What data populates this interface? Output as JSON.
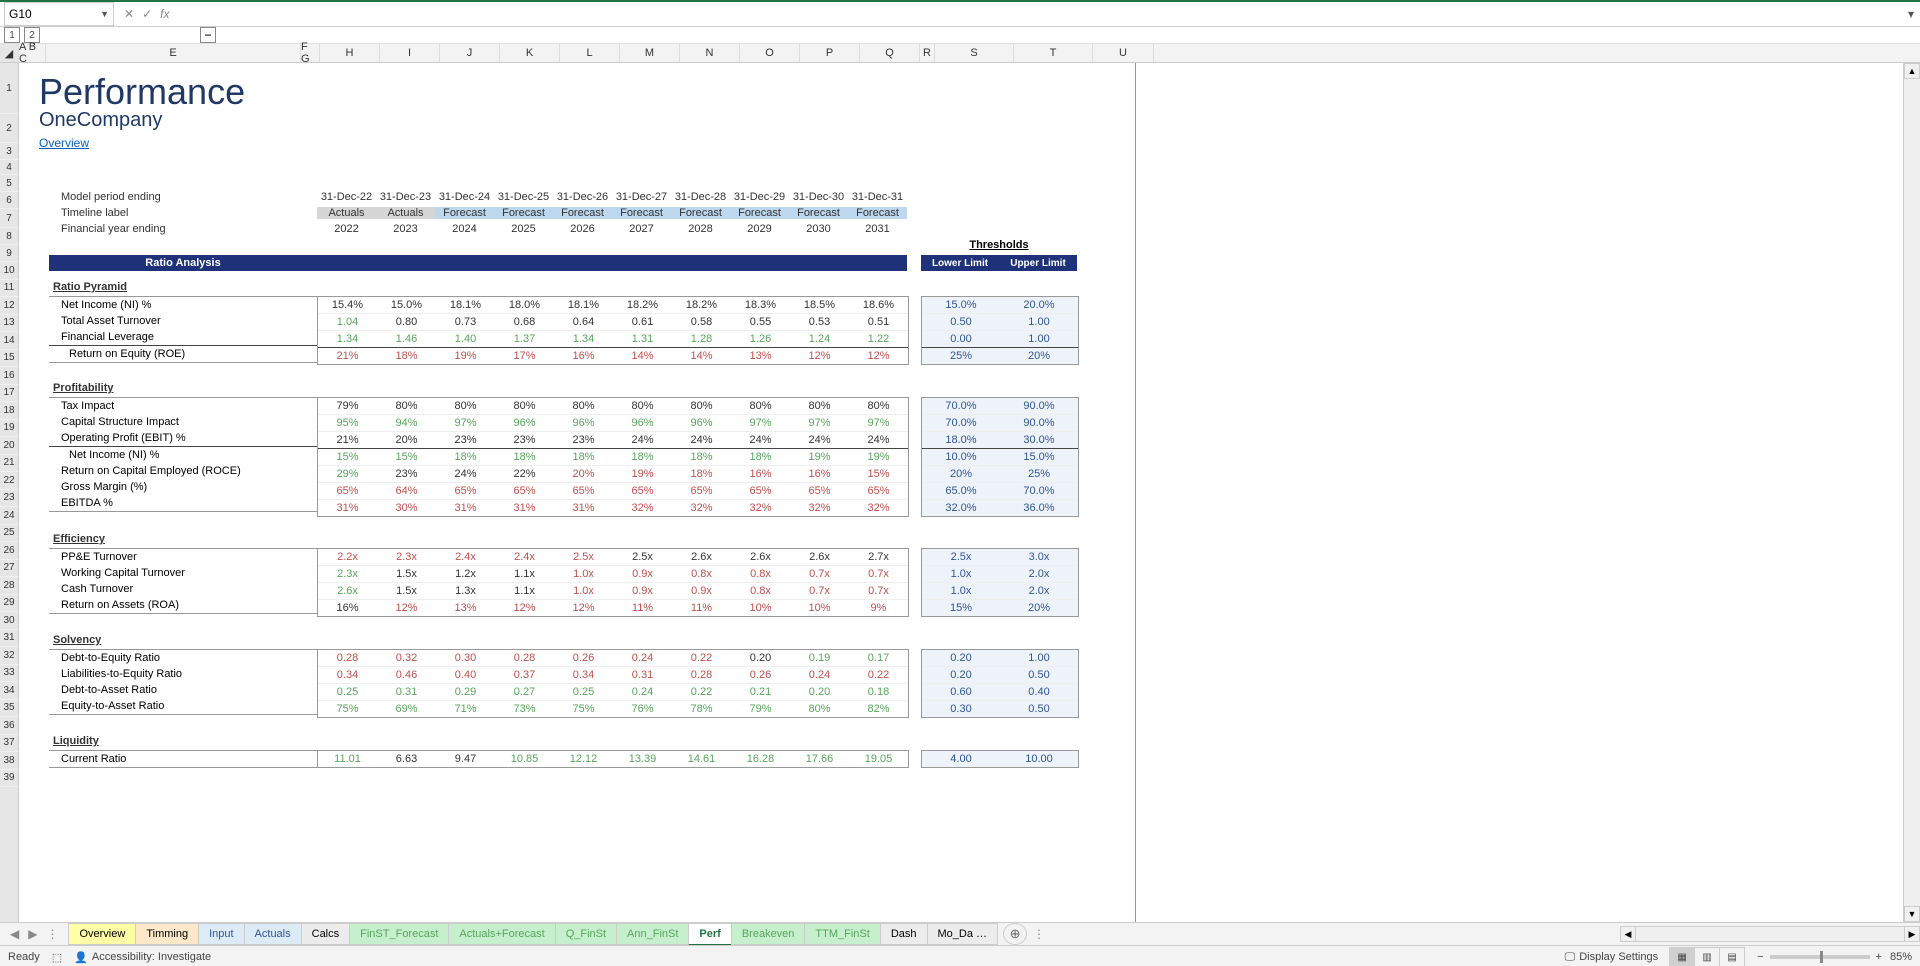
{
  "name_box": "G10",
  "title": "Performance",
  "subtitle": "OneCompany",
  "overview_link": "Overview",
  "outline_labels": [
    "1",
    "2",
    "−"
  ],
  "col_headers": [
    "A",
    "B",
    "C",
    "E",
    "F",
    "G",
    "H",
    "I",
    "J",
    "K",
    "L",
    "M",
    "N",
    "O",
    "P",
    "Q",
    "S",
    "T",
    "U"
  ],
  "meta_rows": {
    "model_period_label": "Model period ending",
    "model_period": [
      "31-Dec-22",
      "31-Dec-23",
      "31-Dec-24",
      "31-Dec-25",
      "31-Dec-26",
      "31-Dec-27",
      "31-Dec-28",
      "31-Dec-29",
      "31-Dec-30",
      "31-Dec-31"
    ],
    "timeline_label": "Timeline label",
    "timeline": [
      "Actuals",
      "Actuals",
      "Forecast",
      "Forecast",
      "Forecast",
      "Forecast",
      "Forecast",
      "Forecast",
      "Forecast",
      "Forecast"
    ],
    "fy_label": "Financial year ending",
    "fy": [
      "2022",
      "2023",
      "2024",
      "2025",
      "2026",
      "2027",
      "2028",
      "2029",
      "2030",
      "2031"
    ]
  },
  "section_bar": "Ratio Analysis",
  "thresholds_label": "Thresholds",
  "th_headers": [
    "Lower Limit",
    "Upper Limit"
  ],
  "groups": [
    {
      "heading": "Ratio Pyramid",
      "rows": [
        {
          "label": "Net Income (NI) %",
          "indent": 1,
          "v": [
            "15.4%",
            "15.0%",
            "18.1%",
            "18.0%",
            "18.1%",
            "18.2%",
            "18.2%",
            "18.3%",
            "18.5%",
            "18.6%"
          ],
          "c": [
            "black",
            "black",
            "black",
            "black",
            "black",
            "black",
            "black",
            "black",
            "black",
            "black"
          ],
          "th": [
            "15.0%",
            "20.0%"
          ]
        },
        {
          "label": "Total Asset Turnover",
          "indent": 1,
          "v": [
            "1.04",
            "0.80",
            "0.73",
            "0.68",
            "0.64",
            "0.61",
            "0.58",
            "0.55",
            "0.53",
            "0.51"
          ],
          "c": [
            "green",
            "black",
            "black",
            "black",
            "black",
            "black",
            "black",
            "black",
            "black",
            "black"
          ],
          "th": [
            "0.50",
            "1.00"
          ]
        },
        {
          "label": "Financial Leverage",
          "indent": 1,
          "v": [
            "1.34",
            "1.46",
            "1.40",
            "1.37",
            "1.34",
            "1.31",
            "1.28",
            "1.26",
            "1.24",
            "1.22"
          ],
          "c": [
            "green",
            "green",
            "green",
            "green",
            "green",
            "green",
            "green",
            "green",
            "green",
            "green"
          ],
          "th": [
            "0.00",
            "1.00"
          ],
          "bb": true
        },
        {
          "label": "Return on Equity (ROE)",
          "indent": 2,
          "v": [
            "21%",
            "18%",
            "19%",
            "17%",
            "16%",
            "14%",
            "14%",
            "13%",
            "12%",
            "12%"
          ],
          "c": [
            "red",
            "red",
            "red",
            "red",
            "red",
            "red",
            "red",
            "red",
            "red",
            "red"
          ],
          "th": [
            "25%",
            "20%"
          ],
          "summary": true
        }
      ]
    },
    {
      "heading": "Profitability",
      "rows": [
        {
          "label": "Tax Impact",
          "indent": 1,
          "v": [
            "79%",
            "80%",
            "80%",
            "80%",
            "80%",
            "80%",
            "80%",
            "80%",
            "80%",
            "80%"
          ],
          "c": [
            "black",
            "black",
            "black",
            "black",
            "black",
            "black",
            "black",
            "black",
            "black",
            "black"
          ],
          "th": [
            "70.0%",
            "90.0%"
          ]
        },
        {
          "label": "Capital Structure Impact",
          "indent": 1,
          "v": [
            "95%",
            "94%",
            "97%",
            "96%",
            "96%",
            "96%",
            "96%",
            "97%",
            "97%",
            "97%"
          ],
          "c": [
            "green",
            "green",
            "green",
            "green",
            "green",
            "green",
            "green",
            "green",
            "green",
            "green"
          ],
          "th": [
            "70.0%",
            "90.0%"
          ]
        },
        {
          "label": "Operating Profit (EBIT) %",
          "indent": 1,
          "v": [
            "21%",
            "20%",
            "23%",
            "23%",
            "23%",
            "24%",
            "24%",
            "24%",
            "24%",
            "24%"
          ],
          "c": [
            "black",
            "black",
            "black",
            "black",
            "black",
            "black",
            "black",
            "black",
            "black",
            "black"
          ],
          "th": [
            "18.0%",
            "30.0%"
          ],
          "bb": true
        },
        {
          "label": "Net Income (NI) %",
          "indent": 2,
          "v": [
            "15%",
            "15%",
            "18%",
            "18%",
            "18%",
            "18%",
            "18%",
            "18%",
            "19%",
            "19%"
          ],
          "c": [
            "green",
            "green",
            "green",
            "green",
            "green",
            "green",
            "green",
            "green",
            "green",
            "green"
          ],
          "th": [
            "10.0%",
            "15.0%"
          ],
          "summary": true
        },
        {
          "label": "Return on Capital Employed (ROCE)",
          "indent": 1,
          "v": [
            "29%",
            "23%",
            "24%",
            "22%",
            "20%",
            "19%",
            "18%",
            "16%",
            "16%",
            "15%"
          ],
          "c": [
            "green",
            "black",
            "black",
            "black",
            "red",
            "red",
            "red",
            "red",
            "red",
            "red"
          ],
          "th": [
            "20%",
            "25%"
          ]
        },
        {
          "label": "Gross Margin (%)",
          "indent": 1,
          "v": [
            "65%",
            "64%",
            "65%",
            "65%",
            "65%",
            "65%",
            "65%",
            "65%",
            "65%",
            "65%"
          ],
          "c": [
            "red",
            "red",
            "red",
            "red",
            "red",
            "red",
            "red",
            "red",
            "red",
            "red"
          ],
          "th": [
            "65.0%",
            "70.0%"
          ]
        },
        {
          "label": "EBITDA %",
          "indent": 1,
          "v": [
            "31%",
            "30%",
            "31%",
            "31%",
            "31%",
            "32%",
            "32%",
            "32%",
            "32%",
            "32%"
          ],
          "c": [
            "red",
            "red",
            "red",
            "red",
            "red",
            "red",
            "red",
            "red",
            "red",
            "red"
          ],
          "th": [
            "32.0%",
            "36.0%"
          ]
        }
      ]
    },
    {
      "heading": "Efficiency",
      "rows": [
        {
          "label": "PP&E Turnover",
          "indent": 1,
          "v": [
            "2.2x",
            "2.3x",
            "2.4x",
            "2.4x",
            "2.5x",
            "2.5x",
            "2.6x",
            "2.6x",
            "2.6x",
            "2.7x"
          ],
          "c": [
            "red",
            "red",
            "red",
            "red",
            "red",
            "black",
            "black",
            "black",
            "black",
            "black"
          ],
          "th": [
            "2.5x",
            "3.0x"
          ]
        },
        {
          "label": "Working Capital Turnover",
          "indent": 1,
          "v": [
            "2.3x",
            "1.5x",
            "1.2x",
            "1.1x",
            "1.0x",
            "0.9x",
            "0.8x",
            "0.8x",
            "0.7x",
            "0.7x"
          ],
          "c": [
            "green",
            "black",
            "black",
            "black",
            "red",
            "red",
            "red",
            "red",
            "red",
            "red"
          ],
          "th": [
            "1.0x",
            "2.0x"
          ]
        },
        {
          "label": "Cash Turnover",
          "indent": 1,
          "v": [
            "2.6x",
            "1.5x",
            "1.3x",
            "1.1x",
            "1.0x",
            "0.9x",
            "0.9x",
            "0.8x",
            "0.7x",
            "0.7x"
          ],
          "c": [
            "green",
            "black",
            "black",
            "black",
            "red",
            "red",
            "red",
            "red",
            "red",
            "red"
          ],
          "th": [
            "1.0x",
            "2.0x"
          ]
        },
        {
          "label": "Return on Assets (ROA)",
          "indent": 1,
          "v": [
            "16%",
            "12%",
            "13%",
            "12%",
            "12%",
            "11%",
            "11%",
            "10%",
            "10%",
            "9%"
          ],
          "c": [
            "black",
            "red",
            "red",
            "red",
            "red",
            "red",
            "red",
            "red",
            "red",
            "red"
          ],
          "th": [
            "15%",
            "20%"
          ]
        }
      ]
    },
    {
      "heading": "Solvency",
      "rows": [
        {
          "label": "Debt-to-Equity Ratio",
          "indent": 1,
          "v": [
            "0.28",
            "0.32",
            "0.30",
            "0.28",
            "0.26",
            "0.24",
            "0.22",
            "0.20",
            "0.19",
            "0.17"
          ],
          "c": [
            "red",
            "red",
            "red",
            "red",
            "red",
            "red",
            "red",
            "black",
            "green",
            "green"
          ],
          "th": [
            "0.20",
            "1.00"
          ]
        },
        {
          "label": "Liabilities-to-Equity Ratio",
          "indent": 1,
          "v": [
            "0.34",
            "0.46",
            "0.40",
            "0.37",
            "0.34",
            "0.31",
            "0.28",
            "0.26",
            "0.24",
            "0.22"
          ],
          "c": [
            "red",
            "red",
            "red",
            "red",
            "red",
            "red",
            "red",
            "red",
            "red",
            "red"
          ],
          "th": [
            "0.20",
            "0.50"
          ]
        },
        {
          "label": "Debt-to-Asset Ratio",
          "indent": 1,
          "v": [
            "0.25",
            "0.31",
            "0.29",
            "0.27",
            "0.25",
            "0.24",
            "0.22",
            "0.21",
            "0.20",
            "0.18"
          ],
          "c": [
            "green",
            "green",
            "green",
            "green",
            "green",
            "green",
            "green",
            "green",
            "green",
            "green"
          ],
          "th": [
            "0.60",
            "0.40"
          ]
        },
        {
          "label": "Equity-to-Asset Ratio",
          "indent": 1,
          "v": [
            "75%",
            "69%",
            "71%",
            "73%",
            "75%",
            "76%",
            "78%",
            "79%",
            "80%",
            "82%"
          ],
          "c": [
            "green",
            "green",
            "green",
            "green",
            "green",
            "green",
            "green",
            "green",
            "green",
            "green"
          ],
          "th": [
            "0.30",
            "0.50"
          ]
        }
      ]
    },
    {
      "heading": "Liquidity",
      "rows": [
        {
          "label": "Current Ratio",
          "indent": 1,
          "v": [
            "11.01",
            "6.63",
            "9.47",
            "10.85",
            "12.12",
            "13.39",
            "14.61",
            "16.28",
            "17.66",
            "19.05"
          ],
          "c": [
            "green",
            "black",
            "black",
            "green",
            "green",
            "green",
            "green",
            "green",
            "green",
            "green"
          ],
          "th": [
            "4.00",
            "10.00"
          ]
        }
      ]
    }
  ],
  "sheet_tabs": [
    {
      "name": "Overview",
      "color": "yellow"
    },
    {
      "name": "Timming",
      "color": "orange"
    },
    {
      "name": "Input",
      "color": "blue"
    },
    {
      "name": "Actuals",
      "color": "blue"
    },
    {
      "name": "Calcs",
      "color": "grey"
    },
    {
      "name": "FinST_Forecast",
      "color": "green"
    },
    {
      "name": "Actuals+Forecast",
      "color": "green"
    },
    {
      "name": "Q_FinSt",
      "color": "green"
    },
    {
      "name": "Ann_FinSt",
      "color": "green"
    },
    {
      "name": "Perf",
      "color": "active"
    },
    {
      "name": "Breakeven",
      "color": "green"
    },
    {
      "name": "TTM_FinSt",
      "color": "green"
    },
    {
      "name": "Dash",
      "color": "grey"
    },
    {
      "name": "Mo_Da …",
      "color": "grey"
    }
  ],
  "status": {
    "ready": "Ready",
    "accessibility": "Accessibility: Investigate",
    "display_settings": "Display Settings",
    "zoom": "85%"
  }
}
